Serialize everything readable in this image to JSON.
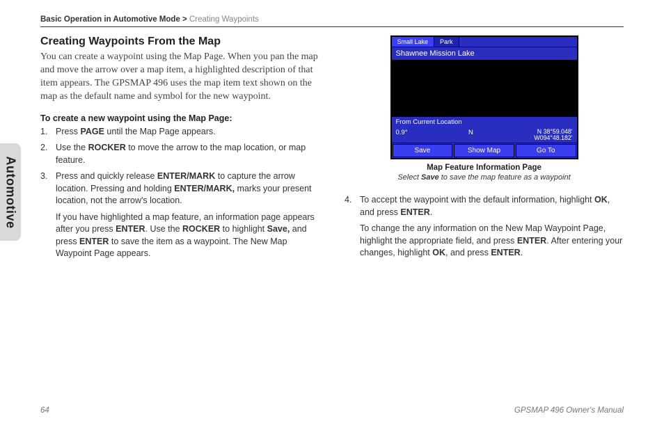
{
  "breadcrumb": {
    "main": "Basic Operation in Automotive Mode >",
    "sub": "Creating Waypoints"
  },
  "sideTab": "Automotive",
  "section": {
    "title": "Creating Waypoints From the Map",
    "intro": "You can create a waypoint using the Map Page. When you pan the map and move the arrow over a map item, a highlighted description of that item appears. The GPSMAP 496 uses the map item text shown on the map as the default name and symbol for the new waypoint.",
    "subhead": "To create a new waypoint using the Map Page:"
  },
  "stepsLeft": [
    {
      "num": "1.",
      "text_a": "Press ",
      "bold_a": "PAGE",
      "text_b": " until the Map Page appears."
    },
    {
      "num": "2.",
      "text_a": "Use the ",
      "bold_a": "ROCKER",
      "text_b": " to move the arrow to the map location, or map feature."
    },
    {
      "num": "3.",
      "body_parts": [
        "Press and quickly release ",
        "ENTER/MARK",
        " to capture the arrow location. Pressing and holding ",
        "ENTER/MARK,",
        " marks your present location, not the arrow's location."
      ],
      "extra_parts": [
        "If you have highlighted a map feature, an information page appears after you press ",
        "ENTER",
        ". Use the ",
        "ROCKER",
        " to highlight ",
        "Save,",
        " and press ",
        "ENTER",
        " to save the item as a waypoint. The New Map Waypoint Page appears."
      ]
    }
  ],
  "device": {
    "tabs": [
      "Small Lake",
      "Park"
    ],
    "title": "Shawnee Mission Lake",
    "locLabel": "From Current Location",
    "dist": "0.9°",
    "dir": "N",
    "coord1": "N 38°59.048'",
    "coord2": "W094°48.182'",
    "buttons": [
      "Save",
      "Show Map",
      "Go To"
    ]
  },
  "caption": {
    "title": "Map Feature Information Page",
    "sub_a": "Select ",
    "sub_bold": "Save",
    "sub_b": " to save the map feature as a waypoint"
  },
  "stepsRight": [
    {
      "num": "4.",
      "body_parts": [
        "To accept the waypoint with the default information, highlight ",
        "OK",
        ", and press ",
        "ENTER",
        "."
      ],
      "extra_parts": [
        "To change the any information on the New Map Waypoint Page, highlight the appropriate field, and press ",
        "ENTER",
        ". After entering your changes, highlight ",
        "OK",
        ", and press ",
        "ENTER",
        "."
      ]
    }
  ],
  "footer": {
    "page": "64",
    "manual": "GPSMAP 496 Owner's Manual"
  }
}
